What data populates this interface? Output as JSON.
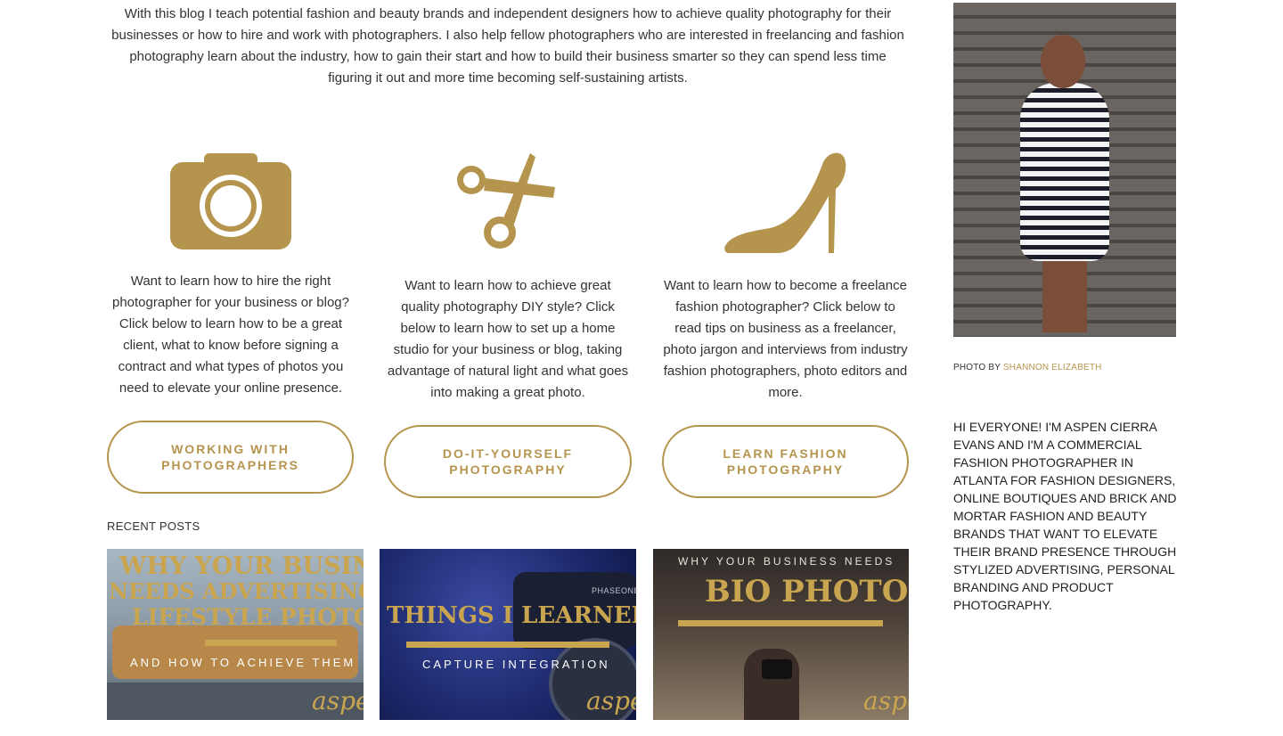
{
  "intro": "With this blog I teach potential fashion and beauty brands and independent designers how to achieve quality photography for their businesses or how to hire and work with photographers. I also help fellow photographers who are interested in freelancing and fashion photography learn about the industry, how to gain their start and how to build their business smarter so they can spend less time figuring it out and more time becoming self-sustaining artists.",
  "columns": [
    {
      "icon": "camera-icon",
      "text": "Want to learn how to hire the right photographer for your business or blog? Click below to learn how to be a great client, what to know before signing a contract and what types of photos you need to elevate your online presence.",
      "button_line1": "WORKING WITH",
      "button_line2": "PHOTOGRAPHERS"
    },
    {
      "icon": "scissors-icon",
      "text": "Want to learn how to achieve great quality photography DIY style? Click below to learn how to set up a home studio for your business or blog, taking advantage of natural light and what goes into making a great photo.",
      "button_line1": "DO-IT-YOURSELF",
      "button_line2": "PHOTOGRAPHY"
    },
    {
      "icon": "high-heel-icon",
      "text": "Want to learn how to become a freelance fashion photographer? Click below to read tips on business as a freelancer, photo jargon and interviews from industry fashion photographers, photo editors and more.",
      "button_line1": "LEARN FASHION",
      "button_line2": "PHOTOGRAPHY"
    }
  ],
  "recent_posts": {
    "heading": "RECENT POSTS",
    "posts": [
      {
        "line1": "WHY YOUR BUSINESS",
        "line2": "NEEDS ADVERTISING AND",
        "line3": "LIFESTYLE PHOTOS",
        "subtitle": "AND HOW TO ACHIEVE THEM",
        "signature": "aspen"
      },
      {
        "line1": "THINGS I LEARNED FROM",
        "subtitle": "CAPTURE INTEGRATION",
        "camera_text": "PHASEONE",
        "signature": "aspen"
      },
      {
        "kicker": "WHY YOUR BUSINESS NEEDS",
        "line1": "BIO PHOTOS",
        "signature": "aspen"
      }
    ]
  },
  "sidebar": {
    "credit_prefix": "PHOTO BY",
    "credit_name": "SHANNON ELIZABETH",
    "about": "HI EVERYONE! I'M ASPEN CIERRA EVANS  AND I'M A COMMERCIAL FASHION PHOTOGRAPHER IN ATLANTA FOR FASHION DESIGNERS, ONLINE BOUTIQUES AND BRICK AND MORTAR FASHION AND BEAUTY BRANDS THAT WANT TO ELEVATE THEIR BRAND PRESENCE THROUGH STYLIZED ADVERTISING, PERSONAL BRANDING AND PRODUCT PHOTOGRAPHY."
  },
  "colors": {
    "gold": "#b5954e",
    "text": "#333333"
  }
}
